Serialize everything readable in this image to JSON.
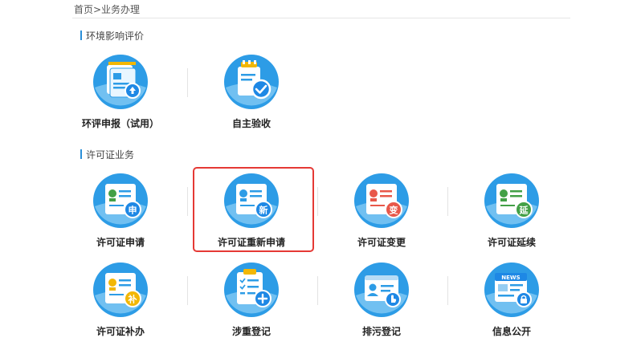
{
  "breadcrumb": "首页>业务办理",
  "sections": {
    "eia": {
      "title": "环境影响评价"
    },
    "permit": {
      "title": "许可证业务"
    }
  },
  "tiles": {
    "eia_report": {
      "label": "环评申报（试用）",
      "icon": "document-upload-icon"
    },
    "self_acceptance": {
      "label": "自主验收",
      "icon": "clipboard-check-icon"
    },
    "permit_apply": {
      "label": "许可证申请",
      "badge": "申",
      "icon": "certificate-apply-icon"
    },
    "permit_renew": {
      "label": "许可证重新申请",
      "badge": "新",
      "icon": "certificate-renew-icon"
    },
    "permit_change": {
      "label": "许可证变更",
      "badge": "变",
      "icon": "certificate-change-icon"
    },
    "permit_extend": {
      "label": "许可证延续",
      "badge": "延",
      "icon": "certificate-extend-icon"
    },
    "permit_supplement": {
      "label": "许可证补办",
      "badge": "补",
      "icon": "certificate-supplement-icon"
    },
    "registration_heavy": {
      "label": "涉重登记",
      "icon": "checklist-add-icon"
    },
    "discharge_registration": {
      "label": "排污登记",
      "icon": "id-card-touch-icon"
    },
    "info_disclosure": {
      "label": "信息公开",
      "news_text": "NEWS",
      "icon": "news-lock-icon"
    }
  },
  "colors": {
    "blue": "#2d9ce6",
    "light_blue": "#9fd8f7",
    "badge_blue": "#1e88e5",
    "red": "#e8584a",
    "green": "#43a047",
    "gold": "#f2b705",
    "highlight": "#e53935"
  }
}
